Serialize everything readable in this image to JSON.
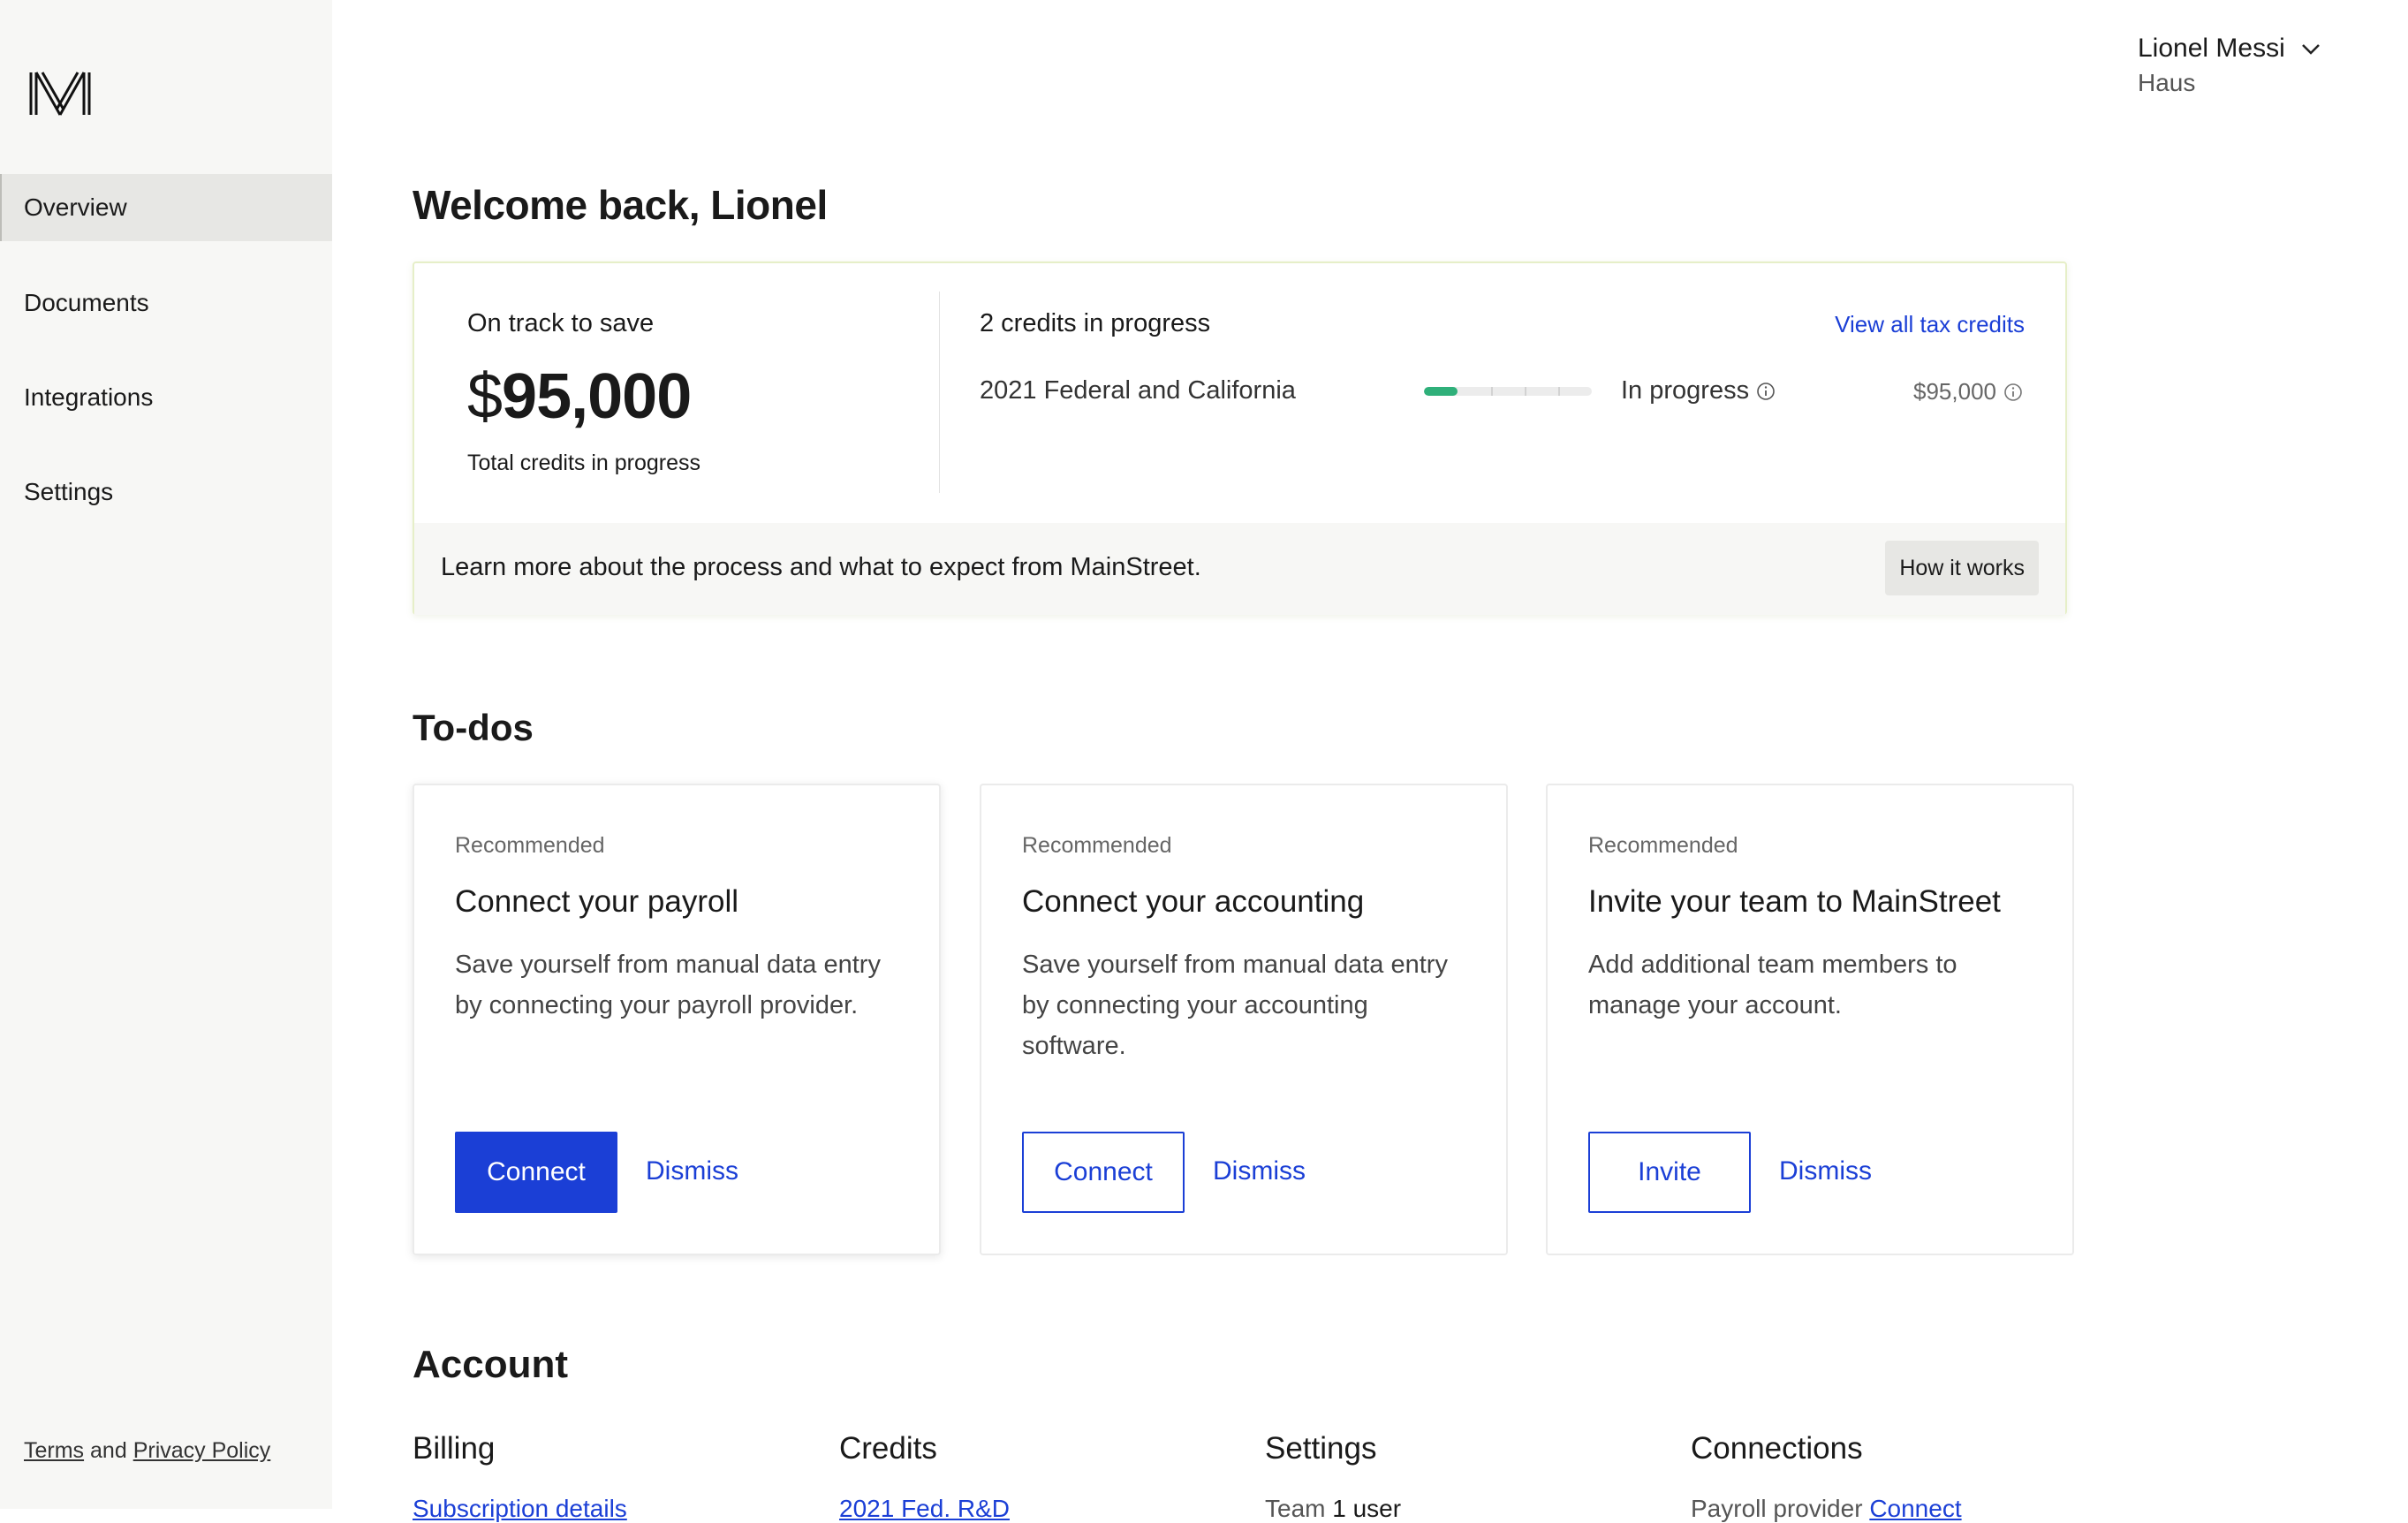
{
  "sidebar": {
    "logo": "logo-m-icon",
    "items": [
      {
        "label": "Overview",
        "active": true
      },
      {
        "label": "Documents",
        "active": false
      },
      {
        "label": "Integrations",
        "active": false
      },
      {
        "label": "Settings",
        "active": false
      }
    ],
    "footer": {
      "terms": "Terms",
      "and": "and",
      "privacy": "Privacy Policy"
    }
  },
  "user": {
    "name": "Lionel Messi",
    "company": "Haus",
    "menu_icon": "chevron-down-icon"
  },
  "welcome": "Welcome back, Lionel",
  "savings": {
    "label": "On track to save",
    "currency": "$",
    "amount": "95,000",
    "sublabel": "Total credits in progress"
  },
  "credits": {
    "title": "2 credits in progress",
    "view_all": "View all tax credits",
    "items": [
      {
        "name": "2021 Federal and California",
        "progress": 0.2,
        "status": "In progress",
        "amount": "$95,000"
      }
    ]
  },
  "card_footer": {
    "text": "Learn more about the process and what to expect from MainStreet.",
    "button": "How it works"
  },
  "todos": {
    "heading": "To-dos",
    "items": [
      {
        "tag": "Recommended",
        "title": "Connect your payroll",
        "description": "Save yourself from manual data entry by connecting your payroll provider.",
        "primary": "Connect",
        "dismiss": "Dismiss"
      },
      {
        "tag": "Recommended",
        "title": "Connect your accounting",
        "description": "Save yourself from manual data entry by connecting your accounting software.",
        "primary": "Connect",
        "dismiss": "Dismiss"
      },
      {
        "tag": "Recommended",
        "title": "Invite your team to MainStreet",
        "description": "Add additional team members to manage your account.",
        "primary": "Invite",
        "dismiss": "Dismiss"
      }
    ]
  },
  "account": {
    "heading": "Account",
    "billing": {
      "title": "Billing",
      "link": "Subscription details"
    },
    "credits": {
      "title": "Credits",
      "link": "2021 Fed. R&D"
    },
    "settings": {
      "title": "Settings",
      "label": "Team",
      "value": "1 user"
    },
    "connections": {
      "title": "Connections",
      "label": "Payroll provider",
      "link": "Connect"
    }
  },
  "colors": {
    "accent": "#1b3fd6",
    "progress": "#2fb07a",
    "sidebar_bg": "#f7f7f5"
  }
}
